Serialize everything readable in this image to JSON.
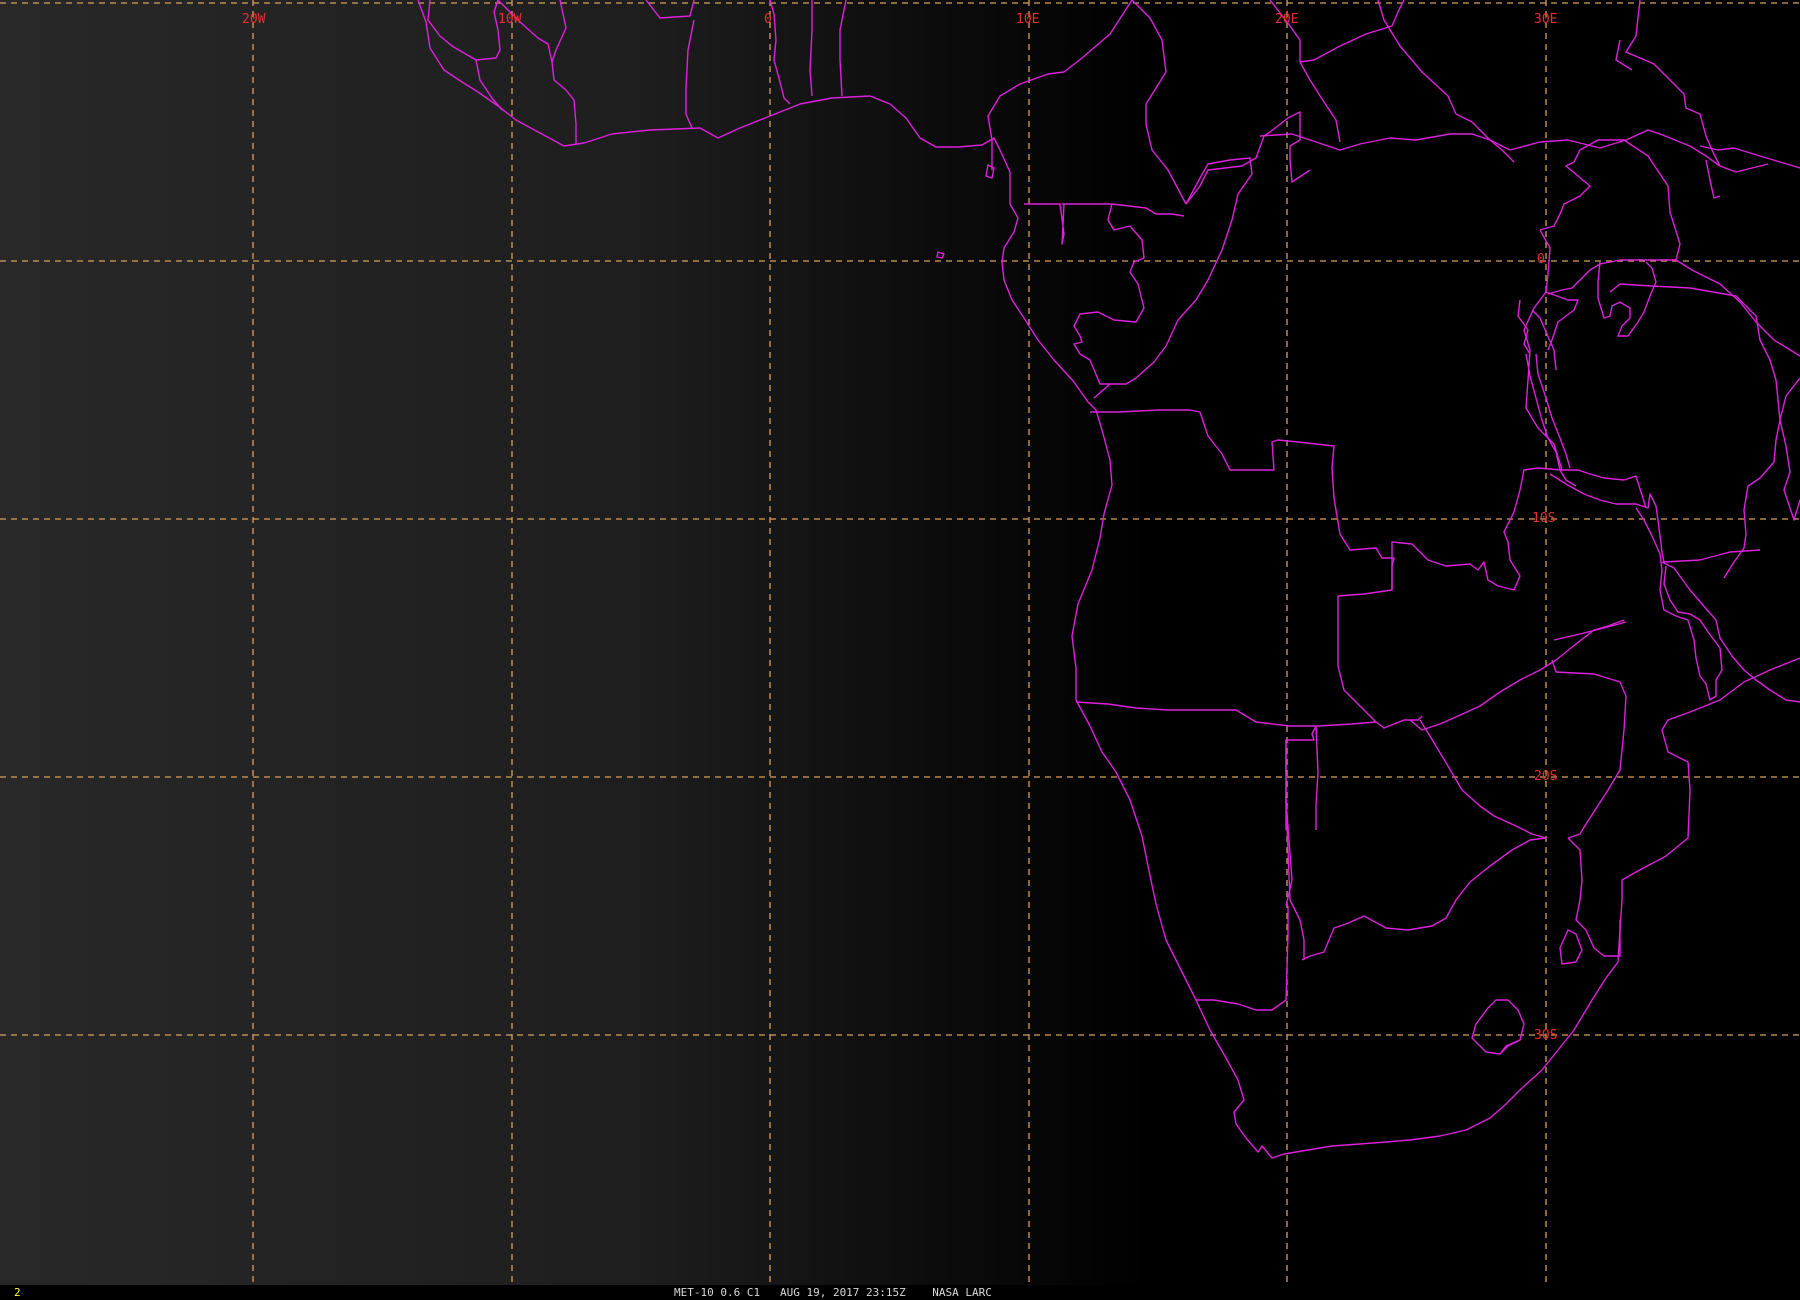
{
  "colors": {
    "gridline": "#d9a05b",
    "border": "#dd22dd",
    "grid_label": "#e83030",
    "background": "#000000"
  },
  "grid": {
    "longitude_labels": [
      "20W",
      "10W",
      "0",
      "10E",
      "20E",
      "30E"
    ],
    "latitude_labels": [
      "0",
      "10S",
      "20S",
      "30S"
    ]
  },
  "status": {
    "frame": "2",
    "satellite": "MET-10",
    "band": "0.6 C1",
    "datetime": "AUG 19, 2017 23:15Z",
    "source": "NASA LARC",
    "caption": "MET-10 0.6 C1   AUG 19, 2017 23:15Z    NASA LARC"
  }
}
